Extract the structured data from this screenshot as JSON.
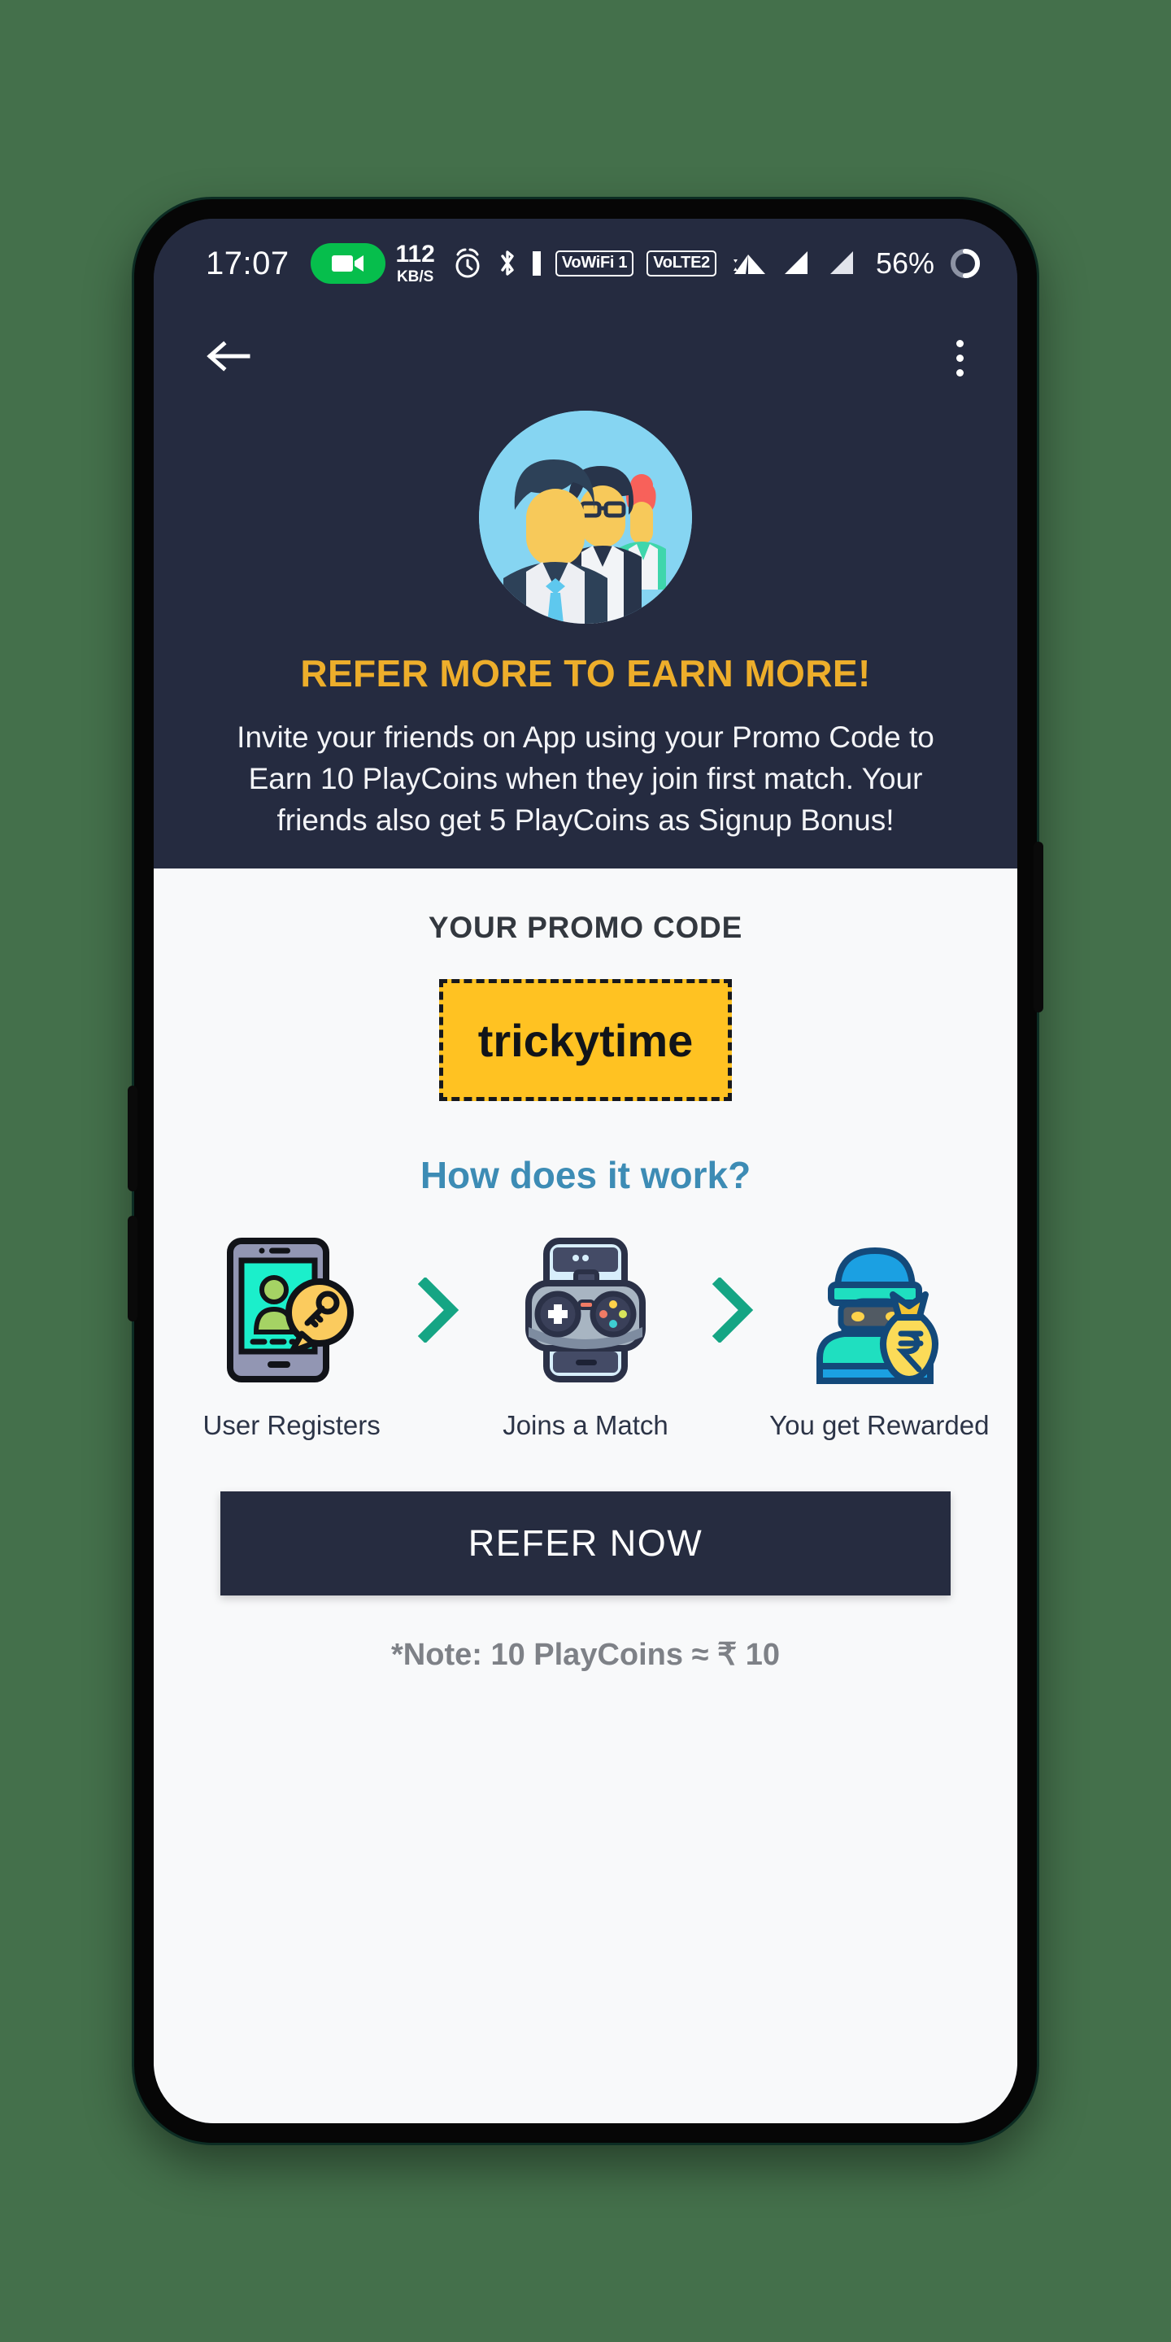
{
  "page": {
    "background_color": "#44704B"
  },
  "status_bar": {
    "time": "17:07",
    "recording_icon": "video-camera-icon",
    "net_speed_value": "112",
    "net_speed_unit": "KB/S",
    "alarm_icon": "alarm-clock-icon",
    "bluetooth_icon": "bluetooth-icon",
    "vowifi_badge": "VoWiFi 1",
    "volte_badge": "VoLTE2",
    "wifi_icon": "wifi-icon",
    "signal_1_icon": "signal-bars-icon",
    "signal_2_icon": "signal-bars-icon",
    "battery_percent": "56%",
    "charging_icon": "battery-ring-icon"
  },
  "app_bar": {
    "back_icon": "back-arrow-icon",
    "overflow_icon": "more-vertical-icon"
  },
  "hero": {
    "avatar_icon": "three-people-avatar-icon",
    "title": "REFER MORE TO EARN MORE!",
    "title_color": "#EDAE2B",
    "description": "Invite your friends on App using your Promo Code to Earn 10 PlayCoins when they join first match. Your friends also get 5 PlayCoins as Signup Bonus!"
  },
  "promo": {
    "label": "YOUR PROMO CODE",
    "code": "trickytime",
    "box_color": "#FFC222"
  },
  "how_it_works": {
    "title": "How does it work?",
    "title_color": "#3D8CB5",
    "arrow_color": "#15A584",
    "steps": [
      {
        "icon": "tablet-user-key-icon",
        "label": "User Registers"
      },
      {
        "icon": "phone-gamepad-icon",
        "label": "Joins a Match"
      },
      {
        "icon": "thief-money-bag-icon",
        "label": "You get Rewarded"
      }
    ],
    "arrows": [
      "chevron-right-icon",
      "chevron-right-icon"
    ]
  },
  "cta": {
    "refer_label": "REFER NOW",
    "note": "*Note: 10 PlayCoins ≈ ₹ 10"
  }
}
